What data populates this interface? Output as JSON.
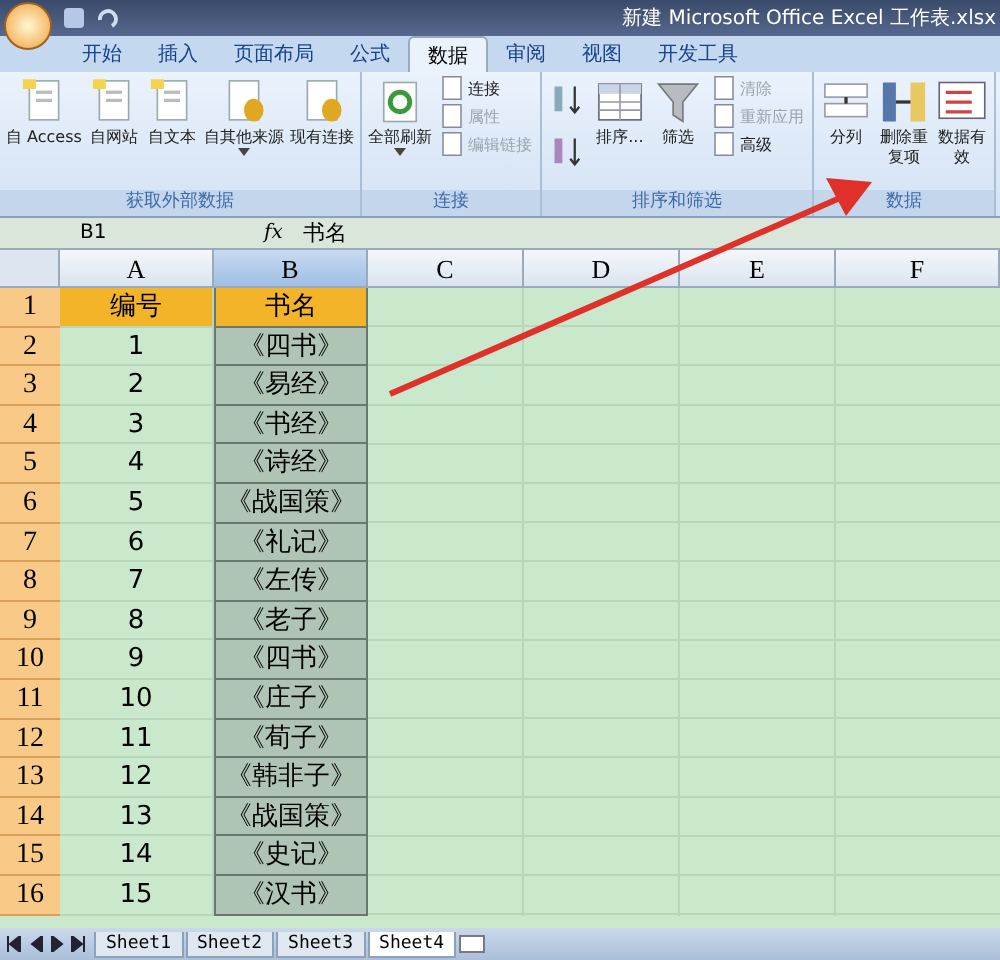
{
  "window": {
    "title": "新建 Microsoft Office Excel 工作表.xlsx"
  },
  "tabs": [
    {
      "label": "开始",
      "selected": false
    },
    {
      "label": "插入",
      "selected": false
    },
    {
      "label": "页面布局",
      "selected": false
    },
    {
      "label": "公式",
      "selected": false
    },
    {
      "label": "数据",
      "selected": true
    },
    {
      "label": "审阅",
      "selected": false
    },
    {
      "label": "视图",
      "selected": false
    },
    {
      "label": "开发工具",
      "selected": false
    }
  ],
  "ribbon": {
    "groups": [
      {
        "label": "获取外部数据",
        "buttons": [
          {
            "kind": "large",
            "label": "自 Access"
          },
          {
            "kind": "large",
            "label": "自网站"
          },
          {
            "kind": "large",
            "label": "自文本"
          },
          {
            "kind": "large",
            "label": "自其他来源",
            "dropdown": true
          },
          {
            "kind": "large",
            "label": "现有连接"
          }
        ]
      },
      {
        "label": "连接",
        "buttons": [
          {
            "kind": "large",
            "label": "全部刷新",
            "dropdown": true
          },
          {
            "kind": "small",
            "label": "连接",
            "disabled": false
          },
          {
            "kind": "small",
            "label": "属性",
            "disabled": true
          },
          {
            "kind": "small",
            "label": "编辑链接",
            "disabled": true
          }
        ]
      },
      {
        "label": "排序和筛选",
        "buttons": [
          {
            "kind": "icon"
          },
          {
            "kind": "icon"
          },
          {
            "kind": "large",
            "label": "排序..."
          },
          {
            "kind": "large",
            "label": "筛选"
          },
          {
            "kind": "small",
            "label": "清除",
            "disabled": true
          },
          {
            "kind": "small",
            "label": "重新应用",
            "disabled": true
          },
          {
            "kind": "small",
            "label": "高级",
            "disabled": false
          }
        ]
      },
      {
        "label": "数据",
        "buttons": [
          {
            "kind": "large",
            "label": "分列"
          },
          {
            "kind": "large",
            "label": "删除重复项"
          },
          {
            "kind": "large",
            "label": "数据有效"
          }
        ]
      }
    ]
  },
  "formula_bar": {
    "name_box": "B1",
    "function_label": "fx",
    "value": "书名"
  },
  "sheet": {
    "columns": [
      {
        "label": "A",
        "selected": false
      },
      {
        "label": "B",
        "selected": true
      },
      {
        "label": "C",
        "selected": false
      },
      {
        "label": "D",
        "selected": false
      },
      {
        "label": "E",
        "selected": false
      },
      {
        "label": "F",
        "selected": false
      }
    ],
    "rows": [
      {
        "header": "1",
        "kind": "header",
        "cells": [
          "编号",
          "书名"
        ]
      },
      {
        "header": "2",
        "kind": "data",
        "cells": [
          "1",
          "《四书》"
        ]
      },
      {
        "header": "3",
        "kind": "data",
        "cells": [
          "2",
          "《易经》"
        ]
      },
      {
        "header": "4",
        "kind": "data",
        "cells": [
          "3",
          "《书经》"
        ]
      },
      {
        "header": "5",
        "kind": "data",
        "cells": [
          "4",
          "《诗经》"
        ]
      },
      {
        "header": "6",
        "kind": "data",
        "cells": [
          "5",
          "《战国策》"
        ]
      },
      {
        "header": "7",
        "kind": "data",
        "cells": [
          "6",
          "《礼记》"
        ]
      },
      {
        "header": "8",
        "kind": "data",
        "cells": [
          "7",
          "《左传》"
        ]
      },
      {
        "header": "9",
        "kind": "data",
        "cells": [
          "8",
          "《老子》"
        ]
      },
      {
        "header": "10",
        "kind": "data",
        "cells": [
          "9",
          "《四书》"
        ]
      },
      {
        "header": "11",
        "kind": "data",
        "cells": [
          "10",
          "《庄子》"
        ]
      },
      {
        "header": "12",
        "kind": "data",
        "cells": [
          "11",
          "《荀子》"
        ]
      },
      {
        "header": "13",
        "kind": "data",
        "cells": [
          "12",
          "《韩非子》"
        ]
      },
      {
        "header": "14",
        "kind": "data",
        "cells": [
          "13",
          "《战国策》"
        ]
      },
      {
        "header": "15",
        "kind": "data",
        "cells": [
          "14",
          "《史记》"
        ]
      },
      {
        "header": "16",
        "kind": "data",
        "cells": [
          "15",
          "《汉书》"
        ]
      }
    ]
  },
  "sheet_tabs": [
    {
      "label": "Sheet1",
      "selected": false
    },
    {
      "label": "Sheet2",
      "selected": false
    },
    {
      "label": "Sheet3",
      "selected": false
    },
    {
      "label": "Sheet4",
      "selected": true
    }
  ]
}
